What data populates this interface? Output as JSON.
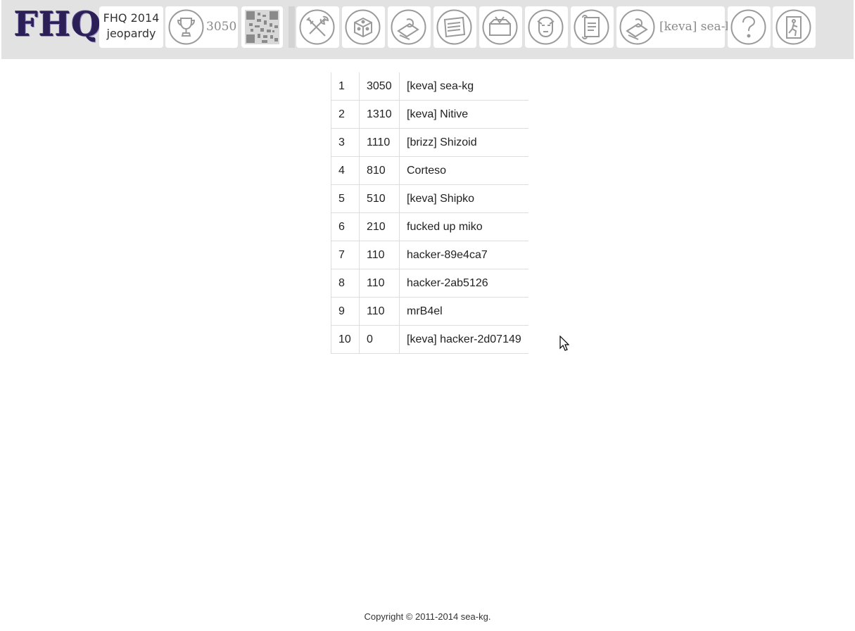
{
  "header": {
    "logo": "FHQ",
    "game_line1": "FHQ 2014",
    "game_line2": "jeopardy",
    "score": "3050",
    "user": "[keva] sea-kg"
  },
  "icons": [
    "trophy-icon",
    "qr-code-icon",
    "tools-icon",
    "dice-icon",
    "hacker-icon",
    "news-icon",
    "feedback-icon",
    "face-icon",
    "scroll-icon",
    "user-icon",
    "help-icon",
    "exit-icon"
  ],
  "scoreboard": [
    {
      "rank": "1",
      "score": "3050",
      "name": "[keva] sea-kg"
    },
    {
      "rank": "2",
      "score": "1310",
      "name": "[keva] Nitive"
    },
    {
      "rank": "3",
      "score": "1110",
      "name": "[brizz] Shizoid"
    },
    {
      "rank": "4",
      "score": "810",
      "name": "Corteso"
    },
    {
      "rank": "5",
      "score": "510",
      "name": "[keva] Shipko"
    },
    {
      "rank": "6",
      "score": "210",
      "name": "fucked up miko"
    },
    {
      "rank": "7",
      "score": "110",
      "name": "hacker-89e4ca7"
    },
    {
      "rank": "8",
      "score": "110",
      "name": "hacker-2ab5126"
    },
    {
      "rank": "9",
      "score": "110",
      "name": "mrB4el"
    },
    {
      "rank": "10",
      "score": "0",
      "name": "[keva] hacker-2d07149"
    }
  ],
  "footer": "Copyright © 2011-2014 sea-kg.",
  "colors": {
    "topbar": "#e2e2e2",
    "tile": "#ffffff",
    "icon_stroke": "#9a9a9a",
    "logo": "#2b1f55"
  }
}
